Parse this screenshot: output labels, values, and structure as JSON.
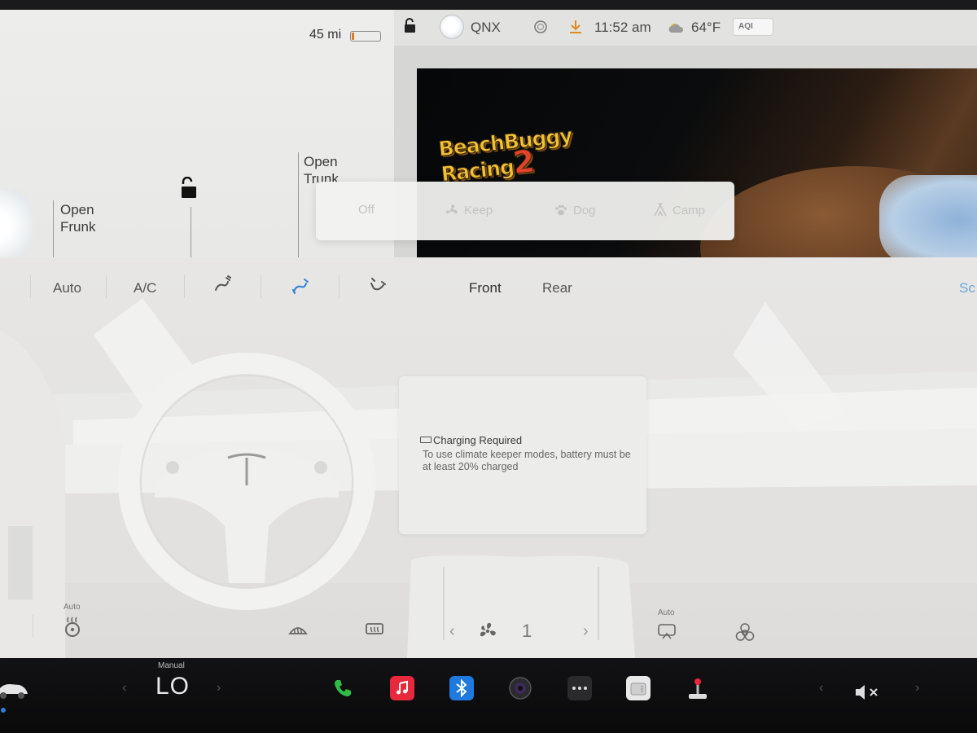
{
  "status_bar": {
    "range": "45 mi",
    "profile_name": "QNX",
    "time": "11:52 am",
    "temperature": "64°F",
    "aqi_label": "AQI",
    "battery_level_fraction": 0.1,
    "battery_color": "#e07b1f"
  },
  "car_panel": {
    "frunk_label_line1": "Open",
    "frunk_label_line2": "Frunk",
    "trunk_label_line1": "Open",
    "trunk_label_line2": "Trunk"
  },
  "game": {
    "title_line1": "BeachBuggy",
    "title_line2": "Racing",
    "title_number": "2"
  },
  "climate_keeper": {
    "modes": [
      {
        "label": "Off",
        "icon": "none"
      },
      {
        "label": "Keep",
        "icon": "fan-icon"
      },
      {
        "label": "Dog",
        "icon": "paw-icon"
      },
      {
        "label": "Camp",
        "icon": "tent-icon"
      }
    ]
  },
  "climate_controls": {
    "auto": "Auto",
    "ac": "A/C",
    "front": "Front",
    "rear": "Rear",
    "screen_edge_text": "Sc"
  },
  "notice": {
    "title": "Charging Required",
    "body": "To use climate keeper modes, battery must be at least 20% charged"
  },
  "bottom_controls": {
    "steering_heat_label": "Auto",
    "recirc_label": "Auto",
    "fan_speed": "1"
  },
  "dock": {
    "temp_mode": "Manual",
    "temp_value": "LO",
    "apps": [
      "phone-icon",
      "music-icon",
      "bluetooth-icon",
      "camera-icon",
      "more-icon",
      "toybox-icon",
      "joystick-icon"
    ],
    "volume_state": "muted",
    "accent_colors": {
      "phone": "#2fbd4a",
      "music": "#e8283c",
      "bluetooth": "#1f7ae0"
    }
  }
}
